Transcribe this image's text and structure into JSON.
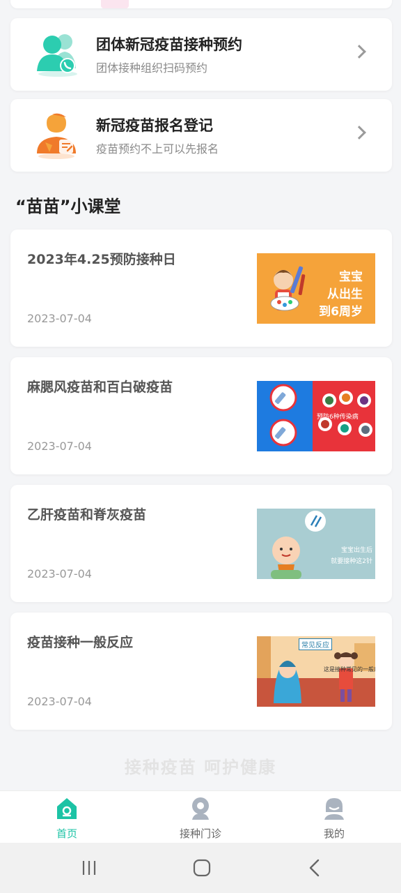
{
  "entries": [
    {
      "title": "团体新冠疫苗接种预约",
      "subtitle": "团体接种组织扫码预约",
      "icon": "group-users-icon"
    },
    {
      "title": "新冠疫苗报名登记",
      "subtitle": "疫苗预约不上可以先报名",
      "icon": "person-register-icon"
    }
  ],
  "section": {
    "title": "“苗苗”小课堂"
  },
  "articles": [
    {
      "title": "2023年4.25预防接种日",
      "date": "2023-07-04",
      "thumb_text": [
        "宝宝",
        "从出生",
        "到6周岁"
      ]
    },
    {
      "title": "麻腮风疫苗和百白破疫苗",
      "date": "2023-07-04",
      "thumb_text": [
        "预防6种传染病"
      ]
    },
    {
      "title": "乙肝疫苗和脊灰疫苗",
      "date": "2023-07-04",
      "thumb_text": [
        "宝宝出生后",
        "就要接种这2针"
      ]
    },
    {
      "title": "疫苗接种一般反应",
      "date": "2023-07-04",
      "thumb_text": [
        "常见反应",
        "这是接种常见的一般反应"
      ]
    }
  ],
  "slogan": "接种疫苗  呵护健康",
  "tabs": [
    {
      "label": "首页",
      "icon": "home-icon",
      "active": true
    },
    {
      "label": "接种门诊",
      "icon": "clinic-location-icon",
      "active": false
    },
    {
      "label": "我的",
      "icon": "profile-icon",
      "active": false
    }
  ],
  "colors": {
    "accent": "#1cc3a5",
    "page_bg": "#f4f5f7",
    "orange": "#f5a33a"
  }
}
